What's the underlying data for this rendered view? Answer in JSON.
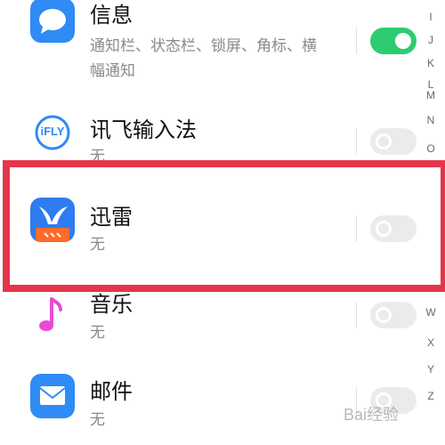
{
  "apps": [
    {
      "name": "信息",
      "subtitle_line1": "通知栏、状态栏、锁屏、角标、横",
      "subtitle_line2": "幅通知",
      "toggle": "on",
      "icon": "message-bubble-icon"
    },
    {
      "name": "讯飞输入法",
      "subtitle": "无",
      "toggle": "off",
      "icon": "ifly-logo-icon",
      "icon_text": "iFLY"
    },
    {
      "name": "迅雷",
      "subtitle": "无",
      "toggle": "off",
      "icon": "xunlei-bird-icon"
    },
    {
      "name": "音乐",
      "subtitle": "无",
      "toggle": "off",
      "icon": "music-note-icon"
    },
    {
      "name": "邮件",
      "subtitle": "无",
      "toggle": "off",
      "icon": "envelope-icon"
    }
  ],
  "index_letters": [
    "I",
    "J",
    "K",
    "L",
    "M",
    "N",
    "O",
    "W",
    "X",
    "Y",
    "Z"
  ],
  "watermark": "Bai经验",
  "colors": {
    "toggle_on": "#2ecc71",
    "toggle_off": "#ebebeb",
    "highlight_border": "#e5354a",
    "messages_icon": "#2f8bf5",
    "mail_icon": "#2f8bf5",
    "xunlei_icon": "#2f7bf0",
    "music_icon": "#e94bd6"
  }
}
